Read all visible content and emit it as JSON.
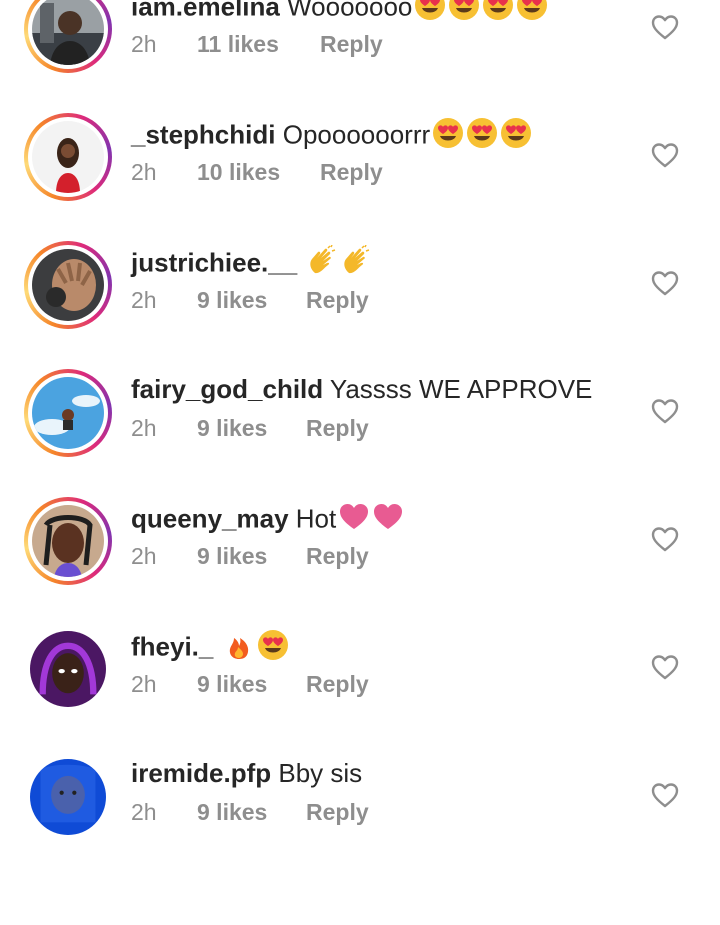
{
  "comments": [
    {
      "username": "iam.emelina",
      "text": "Wooooooo",
      "emojis": [
        "heart-eyes",
        "heart-eyes",
        "heart-eyes",
        "heart-eyes"
      ],
      "time": "2h",
      "likes": "11 likes",
      "reply": "Reply",
      "ring": true,
      "avatar": "photo-dark"
    },
    {
      "username": "_stephchidi",
      "text": "Opoooooorrr",
      "emojis": [
        "heart-eyes",
        "heart-eyes",
        "heart-eyes"
      ],
      "time": "2h",
      "likes": "10 likes",
      "reply": "Reply",
      "ring": true,
      "avatar": "photo-red"
    },
    {
      "username": "justrichiee.__",
      "text": "",
      "emojis": [
        "clap",
        "clap"
      ],
      "time": "2h",
      "likes": "9 likes",
      "reply": "Reply",
      "ring": true,
      "avatar": "photo-hand"
    },
    {
      "username": "fairy_god_child",
      "text": "Yassss WE APPROVE",
      "emojis": [],
      "time": "2h",
      "likes": "9 likes",
      "reply": "Reply",
      "ring": true,
      "avatar": "photo-sky"
    },
    {
      "username": "queeny_may",
      "text": "Hot",
      "emojis": [
        "pink-heart",
        "pink-heart"
      ],
      "time": "2h",
      "likes": "9 likes",
      "reply": "Reply",
      "ring": true,
      "avatar": "photo-braids"
    },
    {
      "username": "fheyi._",
      "text": "",
      "emojis": [
        "fire",
        "heart-eyes"
      ],
      "time": "2h",
      "likes": "9 likes",
      "reply": "Reply",
      "ring": false,
      "avatar": "photo-purple"
    },
    {
      "username": "iremide.pfp",
      "text": "Bby sis",
      "emojis": [],
      "time": "2h",
      "likes": "9 likes",
      "reply": "Reply",
      "ring": false,
      "avatar": "photo-blue"
    }
  ],
  "icons": {
    "like": "heart-outline-icon"
  },
  "colors": {
    "text": "#262626",
    "meta": "#8e8e8e",
    "heart_outline": "#8e8e8e"
  }
}
